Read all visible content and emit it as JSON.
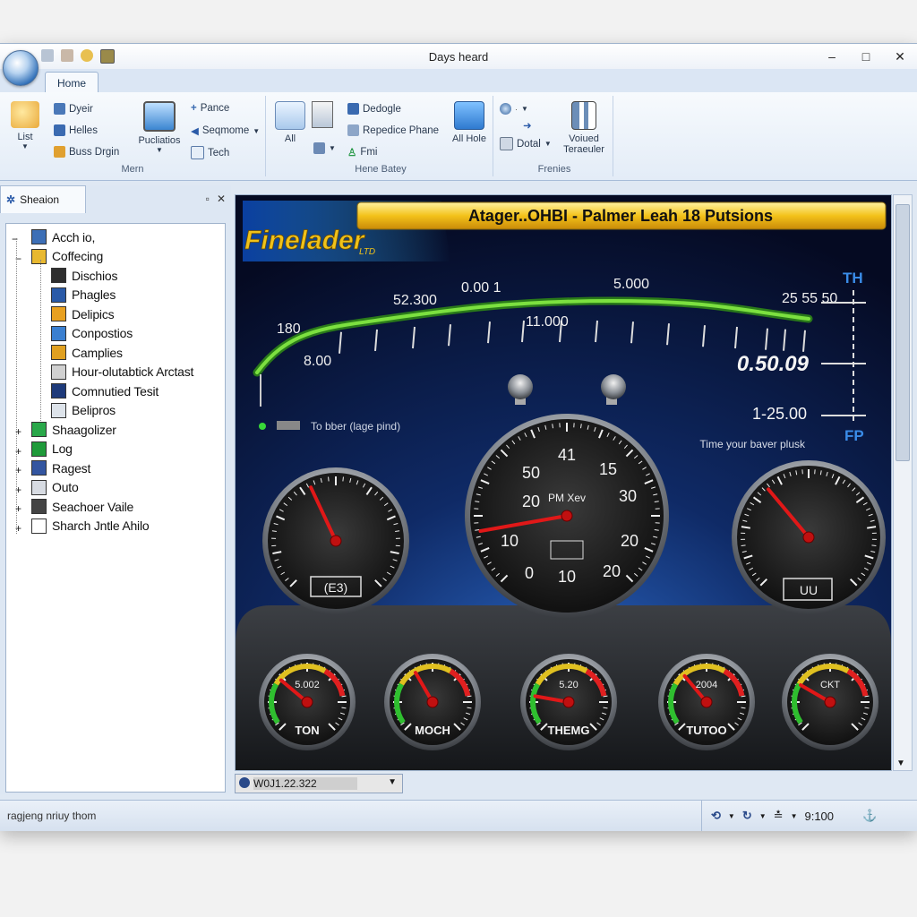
{
  "window": {
    "title": "Days heard",
    "controls": {
      "minimize": "–",
      "maximize": "□",
      "close": "✕"
    }
  },
  "ribbon": {
    "tab": "Home",
    "groups": [
      {
        "label": "Mern",
        "big": [
          {
            "label": "List",
            "icon": "folder-icon"
          }
        ],
        "small": [
          {
            "label": "Dyeir",
            "icon": "doc-icon"
          },
          {
            "label": "Helles",
            "icon": "table-icon"
          },
          {
            "label": "Buss Drgin",
            "icon": "calendar-icon"
          }
        ],
        "big2": [
          {
            "label": "Pucliatios",
            "icon": "monitor-icon"
          }
        ],
        "small2": [
          {
            "label": "Pance",
            "icon": "plus-icon"
          },
          {
            "label": "Seqmome",
            "icon": "speaker-icon"
          },
          {
            "label": "Tech",
            "icon": "image-icon"
          }
        ]
      },
      {
        "label": "Hene Batey",
        "big": [
          {
            "label": "All",
            "icon": "network-icon"
          }
        ],
        "small": [
          {
            "label": "Dedogle",
            "icon": "doc-icon"
          },
          {
            "label": "Repedice Phane",
            "icon": "doc-icon"
          },
          {
            "label": "Fmi",
            "icon": "person-icon"
          }
        ],
        "big2": [
          {
            "label": "All Hole",
            "icon": "folder-icon"
          }
        ]
      },
      {
        "label": "Frenies",
        "small": [
          {
            "label": "",
            "icon": "globe-icon"
          },
          {
            "label": "Dotal",
            "icon": "disk-icon"
          }
        ],
        "big": [
          {
            "label": "Voiued Teraeuler",
            "icon": "chart-icon"
          }
        ]
      }
    ]
  },
  "sidebar": {
    "title": "Sheaion",
    "items": [
      {
        "label": "Acch io,",
        "level": 0,
        "color": "#3d6fb6"
      },
      {
        "label": "Coffecing",
        "level": 1,
        "color": "#e8b830"
      },
      {
        "label": "Dischios",
        "level": 2,
        "color": "#2f2f2f"
      },
      {
        "label": "Phagles",
        "level": 2,
        "color": "#2a5aa8"
      },
      {
        "label": "Delipics",
        "level": 2,
        "color": "#e8a020"
      },
      {
        "label": "Conpostios",
        "level": 2,
        "color": "#3a7fd0"
      },
      {
        "label": "Camplies",
        "level": 2,
        "color": "#e0a020"
      },
      {
        "label": "Hour-olutabtick Arctast",
        "level": 2,
        "color": "#d0d0d0"
      },
      {
        "label": "Comnutied Tesit",
        "level": 2,
        "color": "#1e3a7a"
      },
      {
        "label": "Belipros",
        "level": 2,
        "color": "#dde3ea"
      },
      {
        "label": "Shaagolizer",
        "level": 1,
        "color": "#2aa84a"
      },
      {
        "label": "Log",
        "level": 1,
        "color": "#1f9a3a"
      },
      {
        "label": "Ragest",
        "level": 1,
        "color": "#3355a0"
      },
      {
        "label": "Outo",
        "level": 1,
        "color": "#d7dbe2"
      },
      {
        "label": "Seachoer Vaile",
        "level": 1,
        "color": "#444444"
      },
      {
        "label": "Sharch Jntle Ahilo",
        "level": 1,
        "color": "#ffffff"
      }
    ]
  },
  "dashboard": {
    "logo": "Finelader",
    "logo_sub": "LTD",
    "banner": "Atager..OHBI - Palmer Leah 18 Putsions",
    "curve_labels": [
      "52.300",
      "0.00 1",
      "5.000",
      "25 55 50",
      "180",
      "8.00",
      "11.000"
    ],
    "readout_top": "TH",
    "readout_big": "0.50.09",
    "readout_mid": "1-25.00",
    "readout_bottom": "FP",
    "legend_text": "To bber (lage pind)",
    "hint_text": "Time your baver plusk",
    "main_gauge": {
      "title": "PM Xev",
      "ticks": [
        "41",
        "15",
        "50",
        "30",
        "20",
        "20",
        "10",
        "20",
        "0",
        "10"
      ],
      "value": 0.23
    },
    "left_gauge": {
      "label": "(E3)"
    },
    "right_gauge": {
      "label": "UU"
    },
    "small_gauges": [
      {
        "top": "5.002",
        "label": "TON"
      },
      {
        "top": "",
        "label": "MOCH"
      },
      {
        "top": "5.20",
        "label": "THEMG"
      },
      {
        "top": "2004",
        "label": "TUTOO"
      },
      {
        "top": "CKT",
        "label": ""
      }
    ]
  },
  "combo_value": "W0J1.22.322",
  "status": {
    "text": "ragjeng nriuy thom",
    "tray_value": "9:100"
  }
}
